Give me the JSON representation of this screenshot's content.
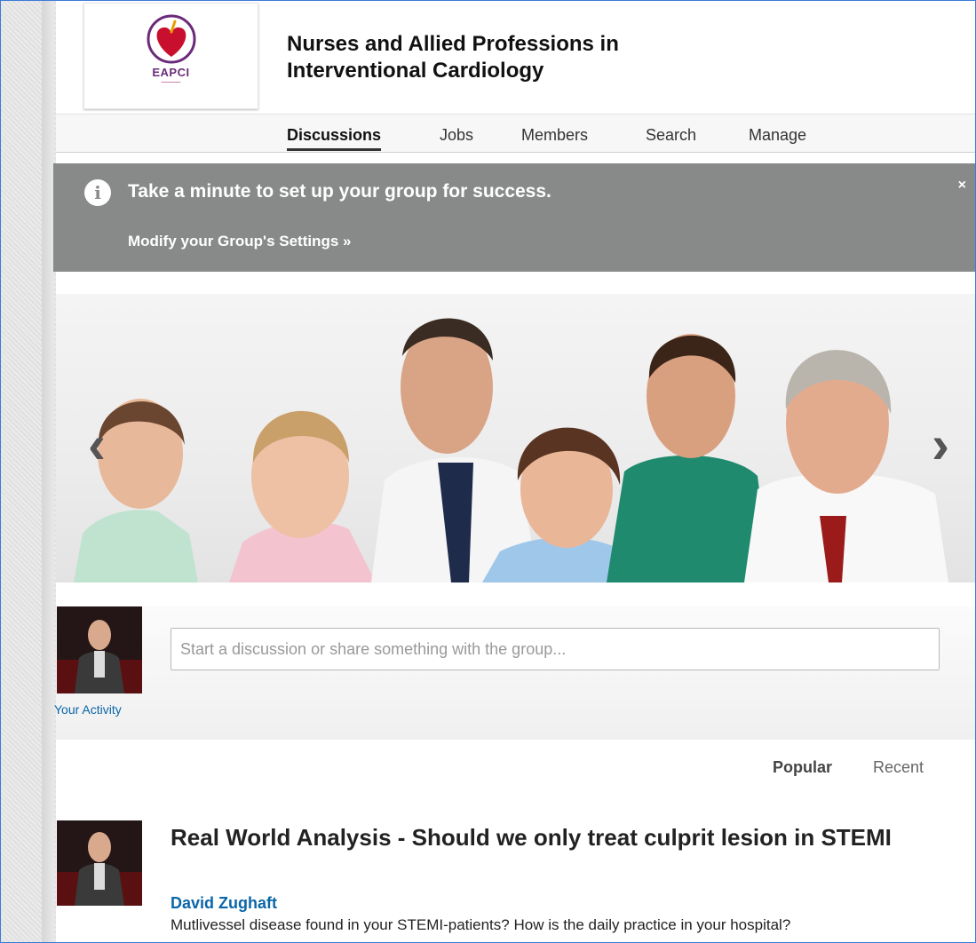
{
  "group": {
    "logo_text": "EAPCI",
    "title": "Nurses and Allied Professions in Interventional Cardiology"
  },
  "nav": {
    "items": [
      {
        "label": "Discussions",
        "active": true
      },
      {
        "label": "Jobs",
        "active": false
      },
      {
        "label": "Members",
        "active": false
      },
      {
        "label": "Search",
        "active": false
      },
      {
        "label": "Manage",
        "active": false
      }
    ]
  },
  "notice": {
    "info_icon": "i",
    "message": "Take a minute to set up your group for success.",
    "link": "Modify your Group's Settings »",
    "close": "×"
  },
  "hero": {
    "prev_arrow": "‹",
    "next_arrow": "›"
  },
  "share": {
    "placeholder": "Start a discussion or share something with the group...",
    "activity_link": "Your Activity"
  },
  "sort": {
    "popular": "Popular",
    "recent": "Recent"
  },
  "post": {
    "title": "Real World Analysis - Should we only treat culprit lesion in STEMI",
    "author": "David Zughaft",
    "excerpt": "Mutlivessel disease found in your STEMI-patients? How is the daily practice in your hospital?"
  },
  "colors": {
    "link": "#0a66a8",
    "notice_bg": "#888a8a",
    "logo_heart": "#c8102e"
  }
}
